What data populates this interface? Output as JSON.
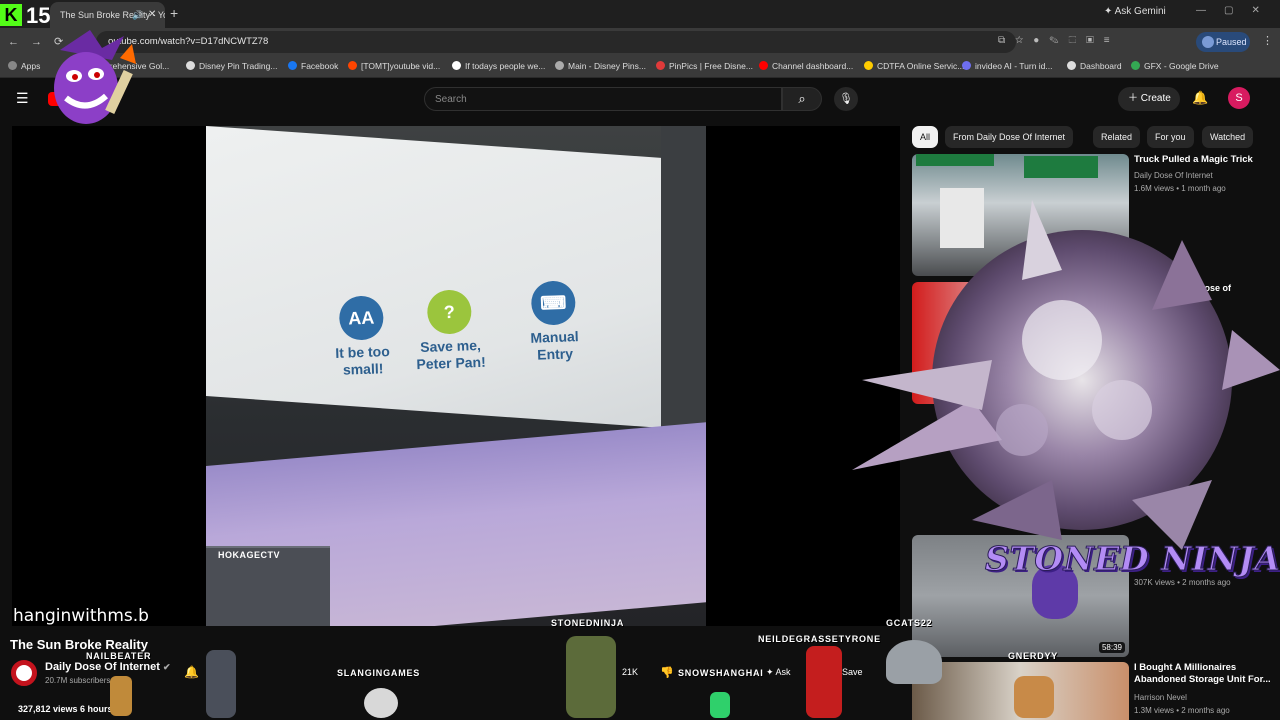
{
  "browser": {
    "tab_title": "The Sun Broke Reality - You",
    "new_tab": "+",
    "ask_gemini": "Ask Gemini",
    "url": "outube.com/watch?v=D17dNCWTZ78",
    "profile_status": "Paused",
    "bookmarks": [
      {
        "label": "Apps",
        "color": "#888888"
      },
      {
        "label": "Comprehensive Gol...",
        "color": "#6a8fd6"
      },
      {
        "label": "Disney Pin Trading...",
        "color": "#dddddd"
      },
      {
        "label": "Facebook",
        "color": "#1877f2"
      },
      {
        "label": "[TOMT]youtube vid...",
        "color": "#ff4500"
      },
      {
        "label": "If todays people we...",
        "color": "#ffffff"
      },
      {
        "label": "Main - Disney Pins...",
        "color": "#aaaaaa"
      },
      {
        "label": "PinPics | Free Disne...",
        "color": "#e03a3a"
      },
      {
        "label": "Channel dashboard...",
        "color": "#ff0000"
      },
      {
        "label": "CDTFA Online Servic...",
        "color": "#ffcc00"
      },
      {
        "label": "invideo AI - Turn id...",
        "color": "#6e6ef0"
      },
      {
        "label": "Dashboard",
        "color": "#dddddd"
      },
      {
        "label": "GFX - Google Drive",
        "color": "#34a853"
      }
    ]
  },
  "youtube": {
    "search_placeholder": "Search",
    "create_label": "Create",
    "avatar_letter": "S",
    "video": {
      "title": "The Sun Broke Reality",
      "channel": "Daily Dose Of Internet",
      "subscribers": "20.7M subscribers",
      "views_line": "327,812 views  6 hours ago",
      "likes": "21K",
      "ask": "Ask",
      "save": "Save"
    },
    "kiosk": [
      {
        "icon": "AA",
        "label": "It be too\nsmall!",
        "color": "#2f6da6"
      },
      {
        "icon": "?",
        "label": "Save me,\nPeter Pan!",
        "color": "#9bc53d"
      },
      {
        "icon": "⌨",
        "label": "Manual\nEntry",
        "color": "#2f6da6"
      }
    ],
    "chips": [
      "All",
      "From Daily Dose Of Internet",
      "Related",
      "For you",
      "Watched"
    ],
    "recommendations": [
      {
        "title": "Truck Pulled a Magic Trick",
        "channel": "Daily Dose Of Internet",
        "meta": "1.6M views • 1 month ago",
        "duration": ""
      },
      {
        "title": "",
        "channel": "Daily Dose of",
        "meta": "",
        "duration": ""
      },
      {
        "title": "",
        "channel": "",
        "meta": "307K views • 2 months ago",
        "duration": "58:39"
      },
      {
        "title": "I Bought A Millionaires Abandoned Storage Unit For...",
        "channel": "Harrison Nevel",
        "meta": "1.3M views • 2 months ago",
        "duration": ""
      }
    ]
  },
  "overlays": {
    "counter": "15",
    "kick": "K",
    "hangin": "hanginwithms.b",
    "hokage": "HOKAGECTV",
    "stoned_ninja": "STONED NINJA",
    "sprite_names": [
      {
        "name": "NAILBEATER"
      },
      {
        "name": "SLANGINGAMES"
      },
      {
        "name": "STONEDNINJA"
      },
      {
        "name": "NEILDEGRASSETYRONE"
      },
      {
        "name": "GCATS22"
      },
      {
        "name": "SNOWSHANGHAI"
      },
      {
        "name": "GNERDYY"
      }
    ]
  }
}
